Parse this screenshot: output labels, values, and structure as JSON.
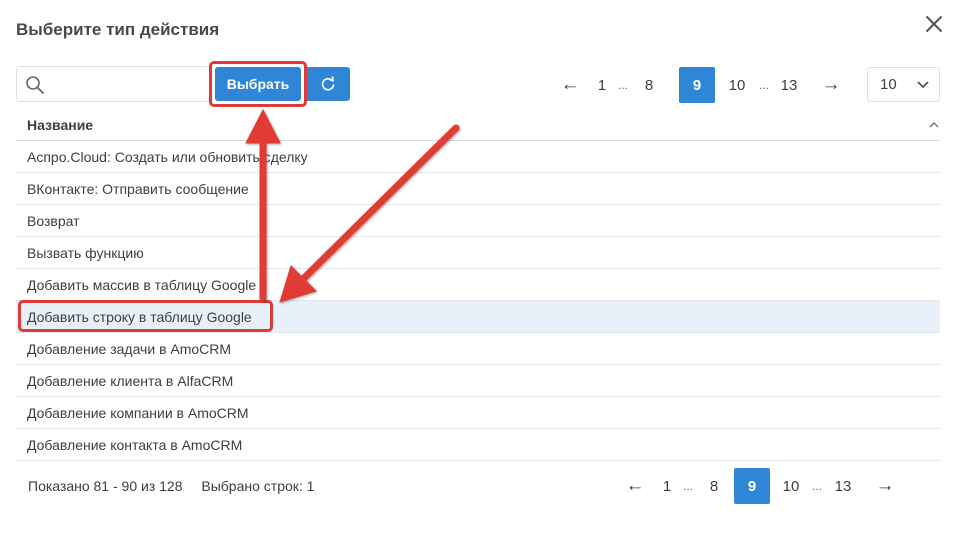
{
  "dialog": {
    "title": "Выберите тип действия"
  },
  "toolbar": {
    "search_placeholder": "",
    "select_label": "Выбрать"
  },
  "pagination": {
    "prev": "←",
    "first": "1",
    "dots1": "...",
    "before": "8",
    "current": "9",
    "after": "10",
    "dots2": "...",
    "last": "13",
    "next": "→"
  },
  "page_size": {
    "value": "10"
  },
  "table": {
    "column": "Название",
    "rows": [
      "Аспро.Cloud: Создать или обновить сделку",
      "ВКонтакте: Отправить сообщение",
      "Возврат",
      "Вызвать функцию",
      "Добавить массив в таблицу Google",
      "Добавить строку в таблицу Google",
      "Добавление задачи в AmoCRM",
      "Добавление клиента в AlfaCRM",
      "Добавление компании в AmoCRM",
      "Добавление контакта в AmoCRM"
    ],
    "selected_index": 5
  },
  "footer": {
    "shown": "Показано 81 - 90 из 128",
    "selected": "Выбрано строк: 1"
  },
  "colors": {
    "accent": "#2f86d6",
    "annotation": "#e03a36",
    "selected_row": "#e8f0fa"
  }
}
